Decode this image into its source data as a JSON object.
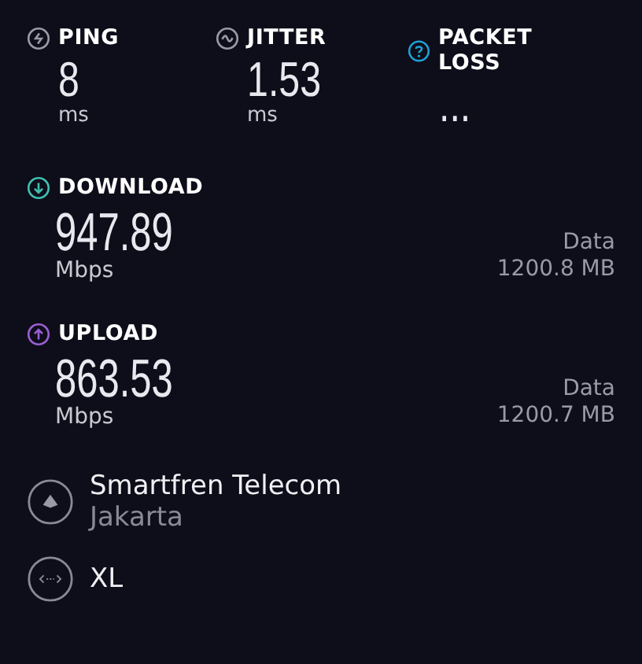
{
  "metrics": [
    {
      "kind": "ping",
      "label": "PING",
      "value": "8",
      "unit": "ms",
      "color": "#9a9aa6"
    },
    {
      "kind": "jitter",
      "label": "JITTER",
      "value": "1.53",
      "unit": "ms",
      "color": "#9a9aa6"
    },
    {
      "kind": "packet_loss",
      "label": "PACKET LOSS",
      "value": "...",
      "color": "#1fa3d6"
    }
  ],
  "transfers": [
    {
      "kind": "download",
      "label": "DOWNLOAD",
      "value": "947.89",
      "unit": "Mbps",
      "data_label": "Data",
      "data_value": "1200.8 MB",
      "color": "#3fbfae"
    },
    {
      "kind": "upload",
      "label": "UPLOAD",
      "value": "863.53",
      "unit": "Mbps",
      "data_label": "Data",
      "data_value": "1200.7 MB",
      "color": "#9b5fd1"
    }
  ],
  "servers": [
    {
      "kind": "server",
      "name": "Smartfren Telecom",
      "location": "Jakarta"
    },
    {
      "kind": "provider",
      "name": "XL"
    }
  ]
}
